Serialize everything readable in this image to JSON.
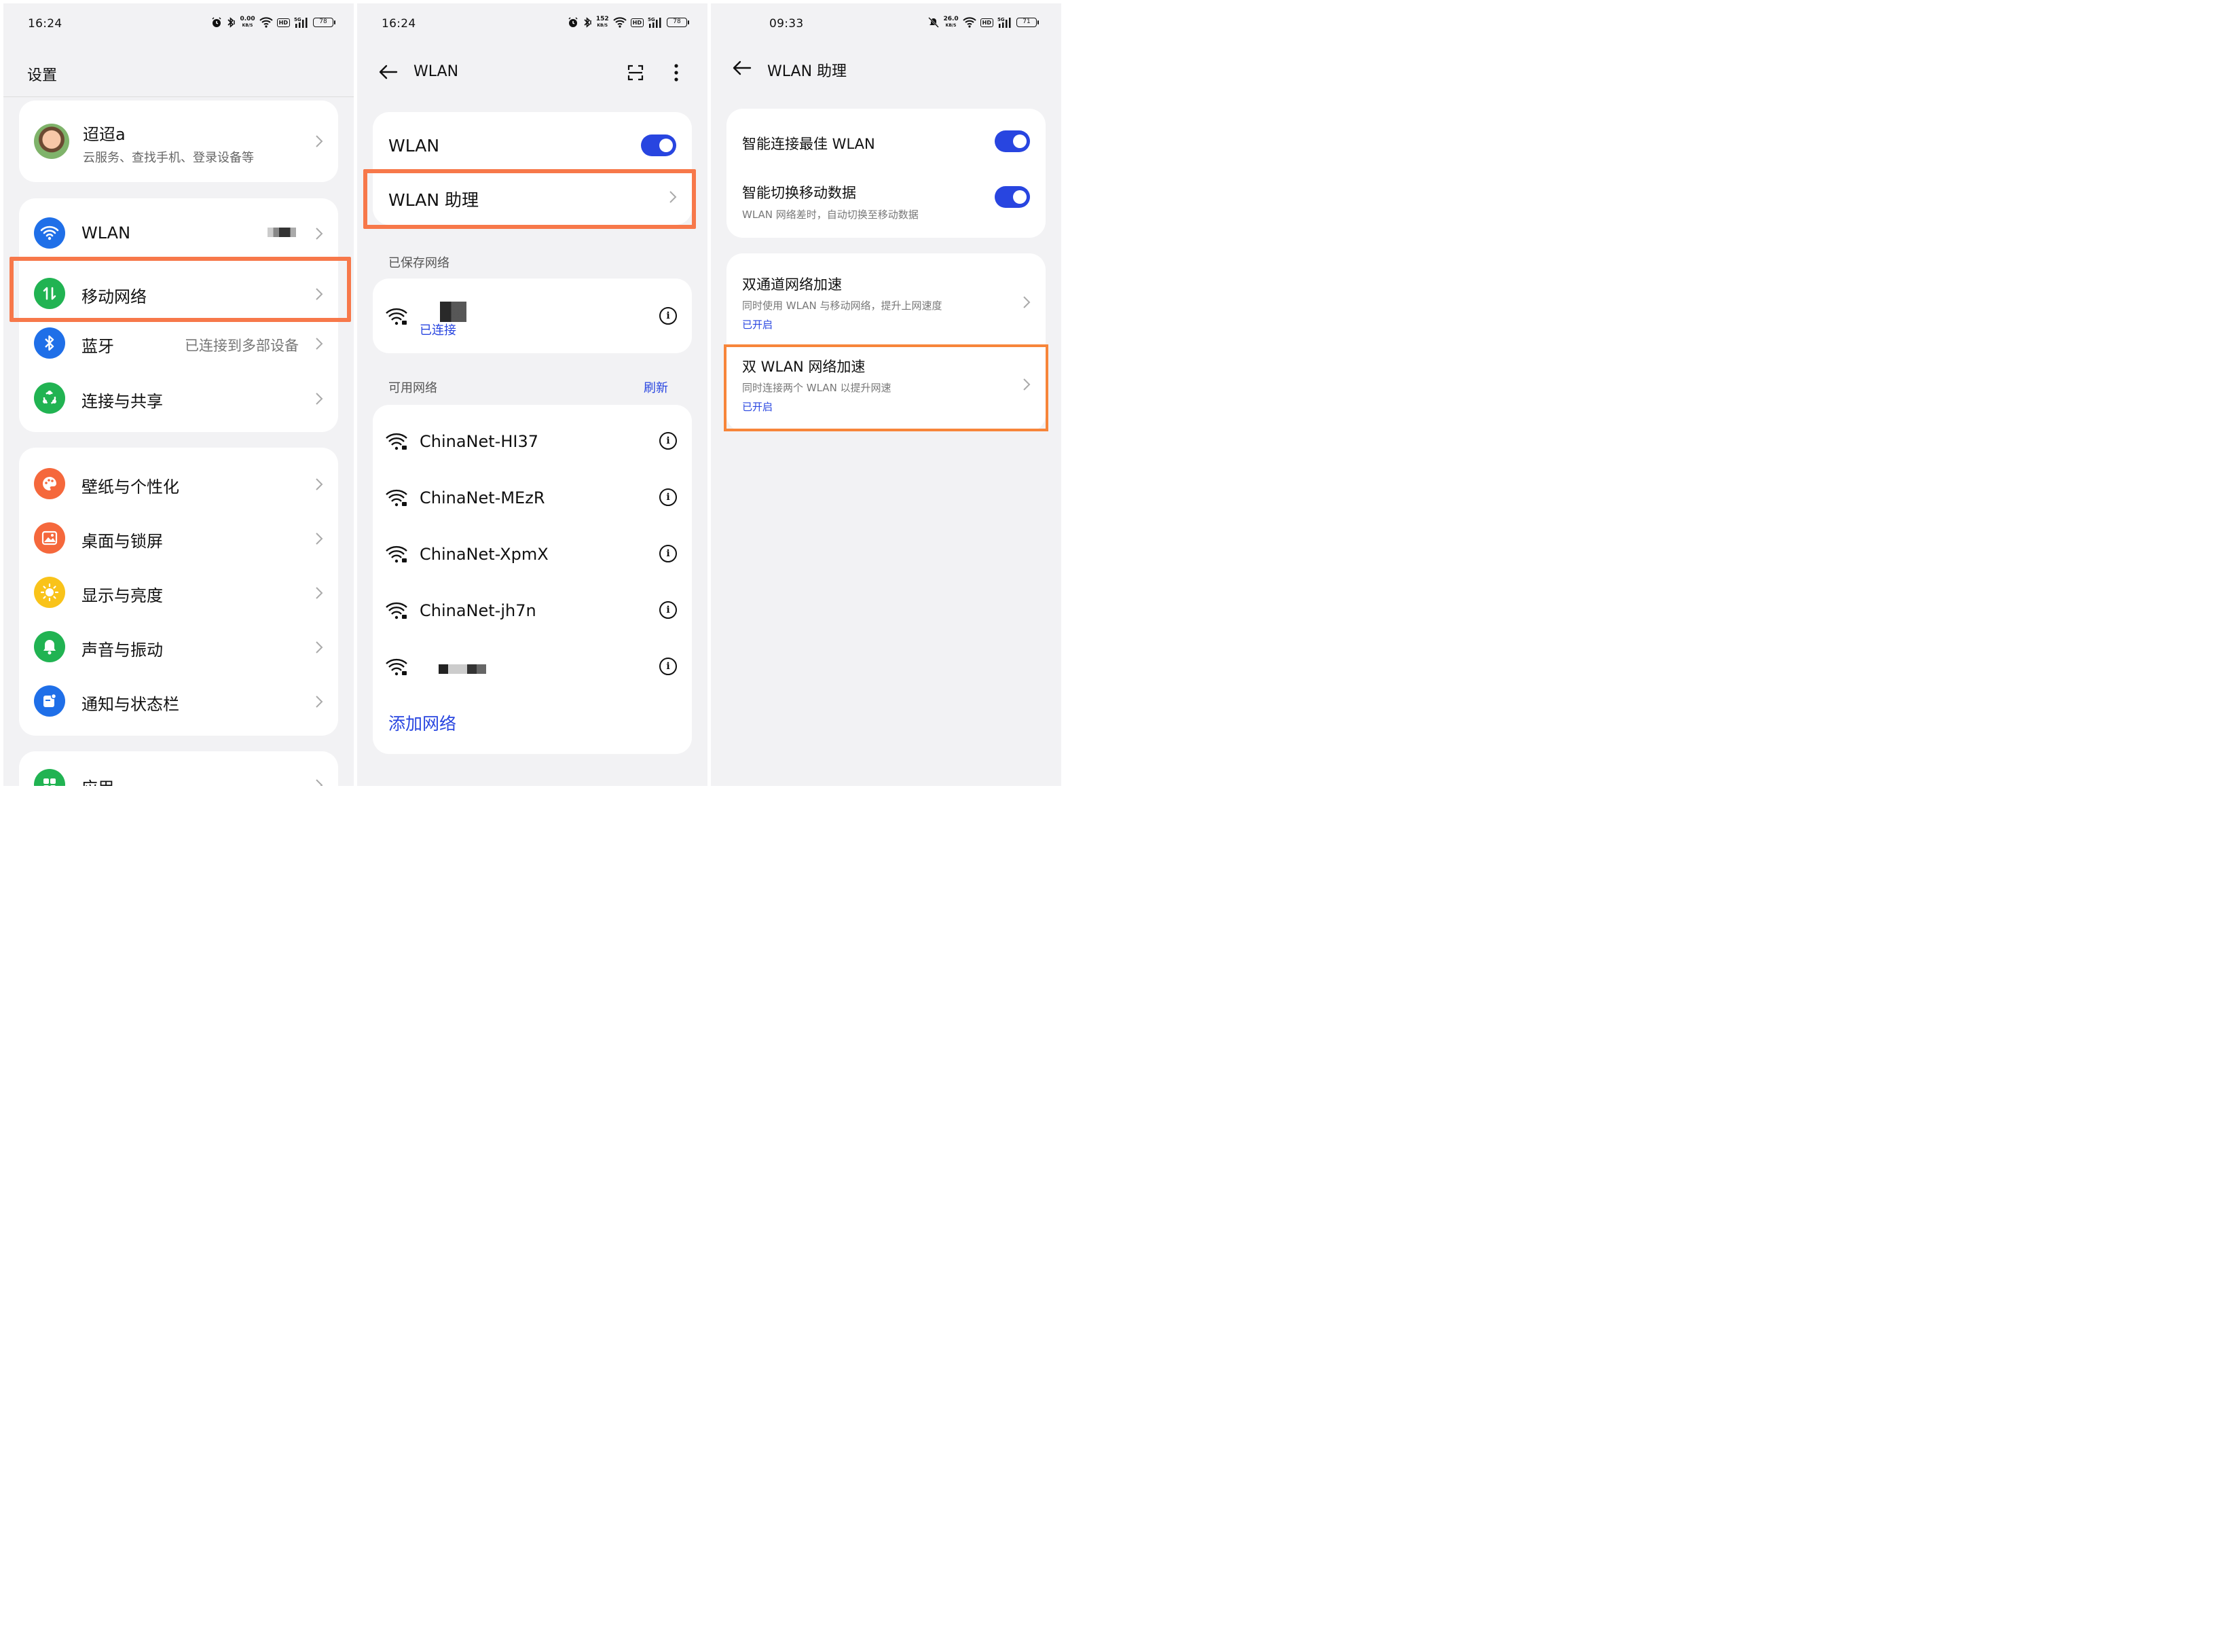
{
  "screen1": {
    "status": {
      "time": "16:24",
      "speed": "0.00",
      "speed_unit": "KB/S",
      "hd": "HD",
      "net": "5G",
      "battery": "78"
    },
    "title": "设置",
    "account": {
      "name": "迢迢a",
      "subtitle": "云服务、查找手机、登录设备等"
    },
    "group1": [
      {
        "label": "WLAN",
        "icon": "wifi-icon",
        "color": "#1f6fe8"
      },
      {
        "label": "移动网络",
        "icon": "mobile-data-icon",
        "color": "#21b352"
      },
      {
        "label": "蓝牙",
        "icon": "bluetooth-icon",
        "color": "#1f6fe8",
        "value": "已连接到多部设备"
      },
      {
        "label": "连接与共享",
        "icon": "share-icon",
        "color": "#21b352"
      }
    ],
    "group2": [
      {
        "label": "壁纸与个性化",
        "icon": "palette-icon",
        "color": "#f5683c"
      },
      {
        "label": "桌面与锁屏",
        "icon": "picture-icon",
        "color": "#f5683c"
      },
      {
        "label": "显示与亮度",
        "icon": "sun-icon",
        "color": "#f9c31a"
      },
      {
        "label": "声音与振动",
        "icon": "bell-icon",
        "color": "#21b352"
      },
      {
        "label": "通知与状态栏",
        "icon": "notification-icon",
        "color": "#1f6fe8"
      }
    ],
    "group3": [
      {
        "label": "应用",
        "icon": "apps-icon",
        "color": "#21b352"
      }
    ]
  },
  "screen2": {
    "status": {
      "time": "16:24",
      "speed": "152",
      "speed_unit": "KB/S",
      "hd": "HD",
      "net": "5G",
      "battery": "78"
    },
    "title": "WLAN",
    "wlan_label": "WLAN",
    "assistant_label": "WLAN 助理",
    "saved_header": "已保存网络",
    "saved_status": "已连接",
    "available_header": "可用网络",
    "refresh": "刷新",
    "networks": [
      "ChinaNet-HI37",
      "ChinaNet-MEzR",
      "ChinaNet-XpmX",
      "ChinaNet-jh7n"
    ],
    "add_network": "添加网络"
  },
  "screen3": {
    "status": {
      "time": "09:33",
      "speed": "26.0",
      "speed_unit": "KB/S",
      "hd": "HD",
      "net": "5G",
      "battery": "71"
    },
    "title": "WLAN 助理",
    "smart_connect": "智能连接最佳 WLAN",
    "smart_switch": "智能切换移动数据",
    "smart_switch_sub": "WLAN 网络差时，自动切换至移动数据",
    "dual_channel": {
      "title": "双通道网络加速",
      "sub": "同时使用 WLAN 与移动网络，提升上网速度",
      "status": "已开启"
    },
    "dual_wlan": {
      "title": "双 WLAN 网络加速",
      "sub": "同时连接两个 WLAN 以提升网速",
      "status": "已开启"
    }
  }
}
